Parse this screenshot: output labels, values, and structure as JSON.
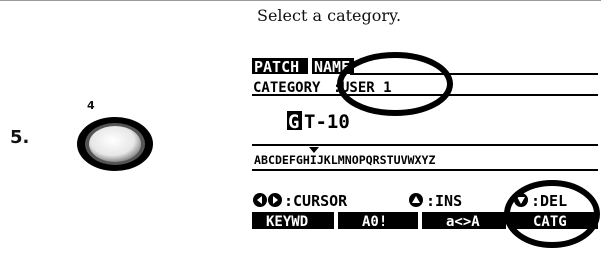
{
  "instruction": "Select a category.",
  "step_number": "5.",
  "knob_number": "4",
  "lcd": {
    "header_label": "PATCH",
    "name_label": "NAME",
    "category_label": "CATEGORY",
    "category_value": "USER 1",
    "patch_name": "GT-10",
    "char_row": "ABCDEFGHIJKLMNOPQRSTUVWXYZ",
    "cursor_label": ":CURSOR",
    "ins_label": ":INS",
    "del_label": ":DEL",
    "tabs": [
      "KEYWD",
      "A0!",
      "a<>A",
      "CATG"
    ]
  },
  "colors": {
    "lcd_ink": "#000000",
    "highlight_ring": "#000000"
  }
}
